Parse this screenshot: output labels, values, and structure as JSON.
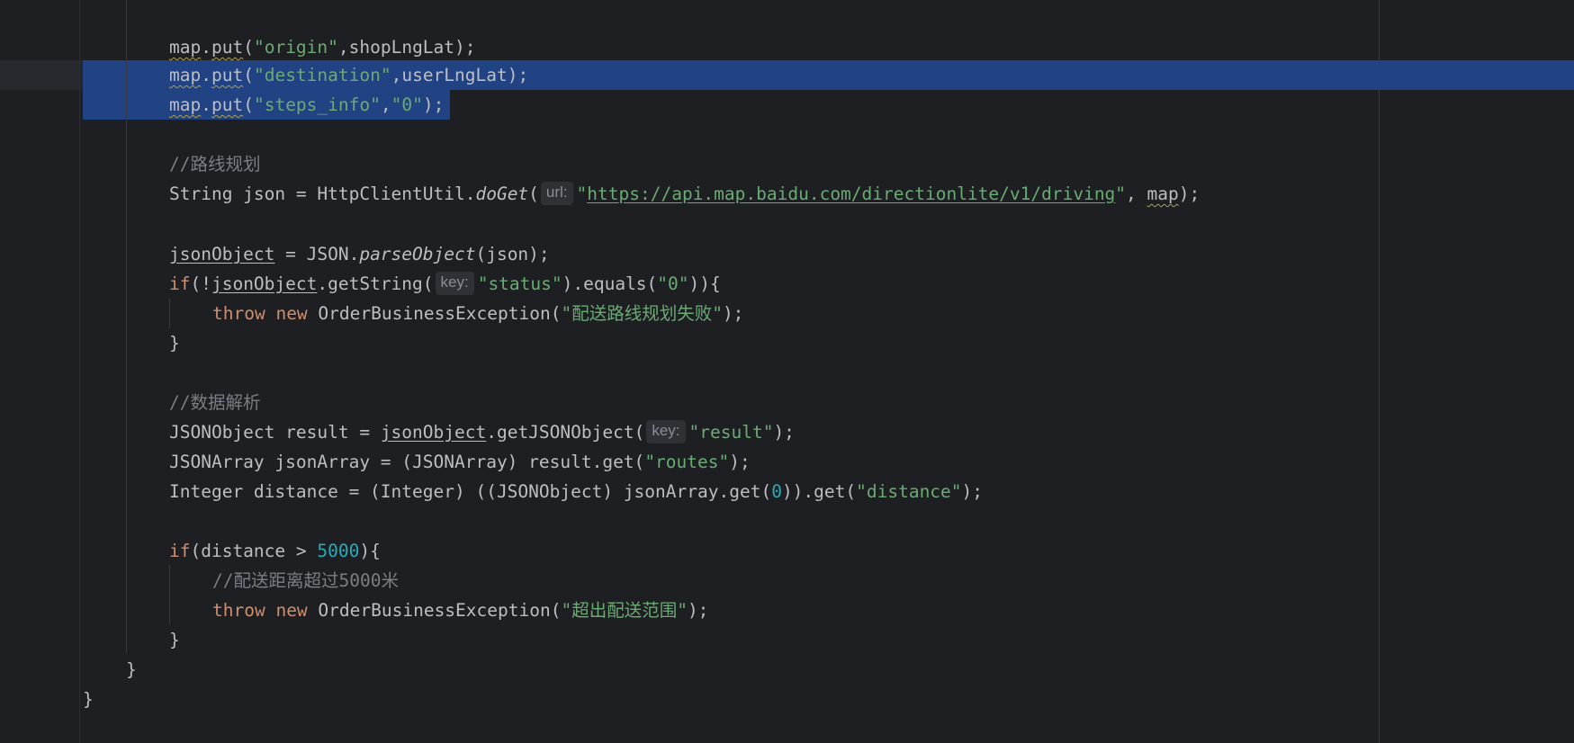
{
  "code": {
    "l1": {
      "recv": "map",
      "dot": ".",
      "m": "put",
      "open": "(",
      "s1": "\"origin\"",
      "rest": ",shopLngLat);"
    },
    "l2": {
      "recv": "map",
      "dot": ".",
      "m": "put",
      "open": "(",
      "s1": "\"destination\"",
      "rest": ",userLngLat);"
    },
    "l3": {
      "recv": "map",
      "dot": ".",
      "m": "put",
      "open": "(",
      "s1": "\"steps_info\"",
      "comma": ",",
      "s2": "\"0\"",
      "rest": ");"
    },
    "c1": "//路线规划",
    "l4": {
      "a": "String json = HttpClientUtil.",
      "m": "doGet",
      "open": "(",
      "hint": "url:",
      "q1": "\"",
      "url": "https://api.map.baidu.com/directionlite/v1/driving",
      "q2": "\"",
      "comma": ", ",
      "arg": "map",
      "rest": ");"
    },
    "l5": {
      "var": "jsonObject",
      "a": " = JSON.",
      "m": "parseObject",
      "rest": "(json);"
    },
    "l6": {
      "kw": "if",
      "a": "(!",
      "var": "jsonObject",
      "b": ".getString(",
      "hint": "key:",
      "s": "\"status\"",
      "c": ").equals(",
      "s2": "\"0\"",
      "rest": ")){"
    },
    "l7": {
      "kw1": "throw",
      "sp": " ",
      "kw2": "new",
      "a": " OrderBusinessException(",
      "s": "\"配送路线规划失败\"",
      "rest": ");"
    },
    "l8": "}",
    "c2": "//数据解析",
    "l9": {
      "a": "JSONObject result = ",
      "var": "jsonObject",
      "b": ".getJSONObject(",
      "hint": "key:",
      "s": "\"result\"",
      "rest": ");"
    },
    "l10": {
      "a": "JSONArray jsonArray = (JSONArray) result.get(",
      "s": "\"routes\"",
      "rest": ");"
    },
    "l11": {
      "a": "Integer distance = (Integer) ((JSONObject) jsonArray.get(",
      "n": "0",
      "b": ")).get(",
      "s": "\"distance\"",
      "rest": ");"
    },
    "l12": {
      "kw": "if",
      "a": "(distance > ",
      "n": "5000",
      "rest": "){"
    },
    "c3": "//配送距离超过5000米",
    "l13": {
      "kw1": "throw",
      "sp": " ",
      "kw2": "new",
      "a": " OrderBusinessException(",
      "s": "\"超出配送范围\"",
      "rest": ");"
    },
    "l14": "}",
    "l15": "}",
    "l16": "}"
  },
  "colors": {
    "background": "#1e1f22",
    "selection": "#214283",
    "string": "#6aab73",
    "keyword": "#cf8e6d",
    "number": "#2aacb8",
    "comment": "#7a7e85",
    "text": "#bcbec4"
  }
}
